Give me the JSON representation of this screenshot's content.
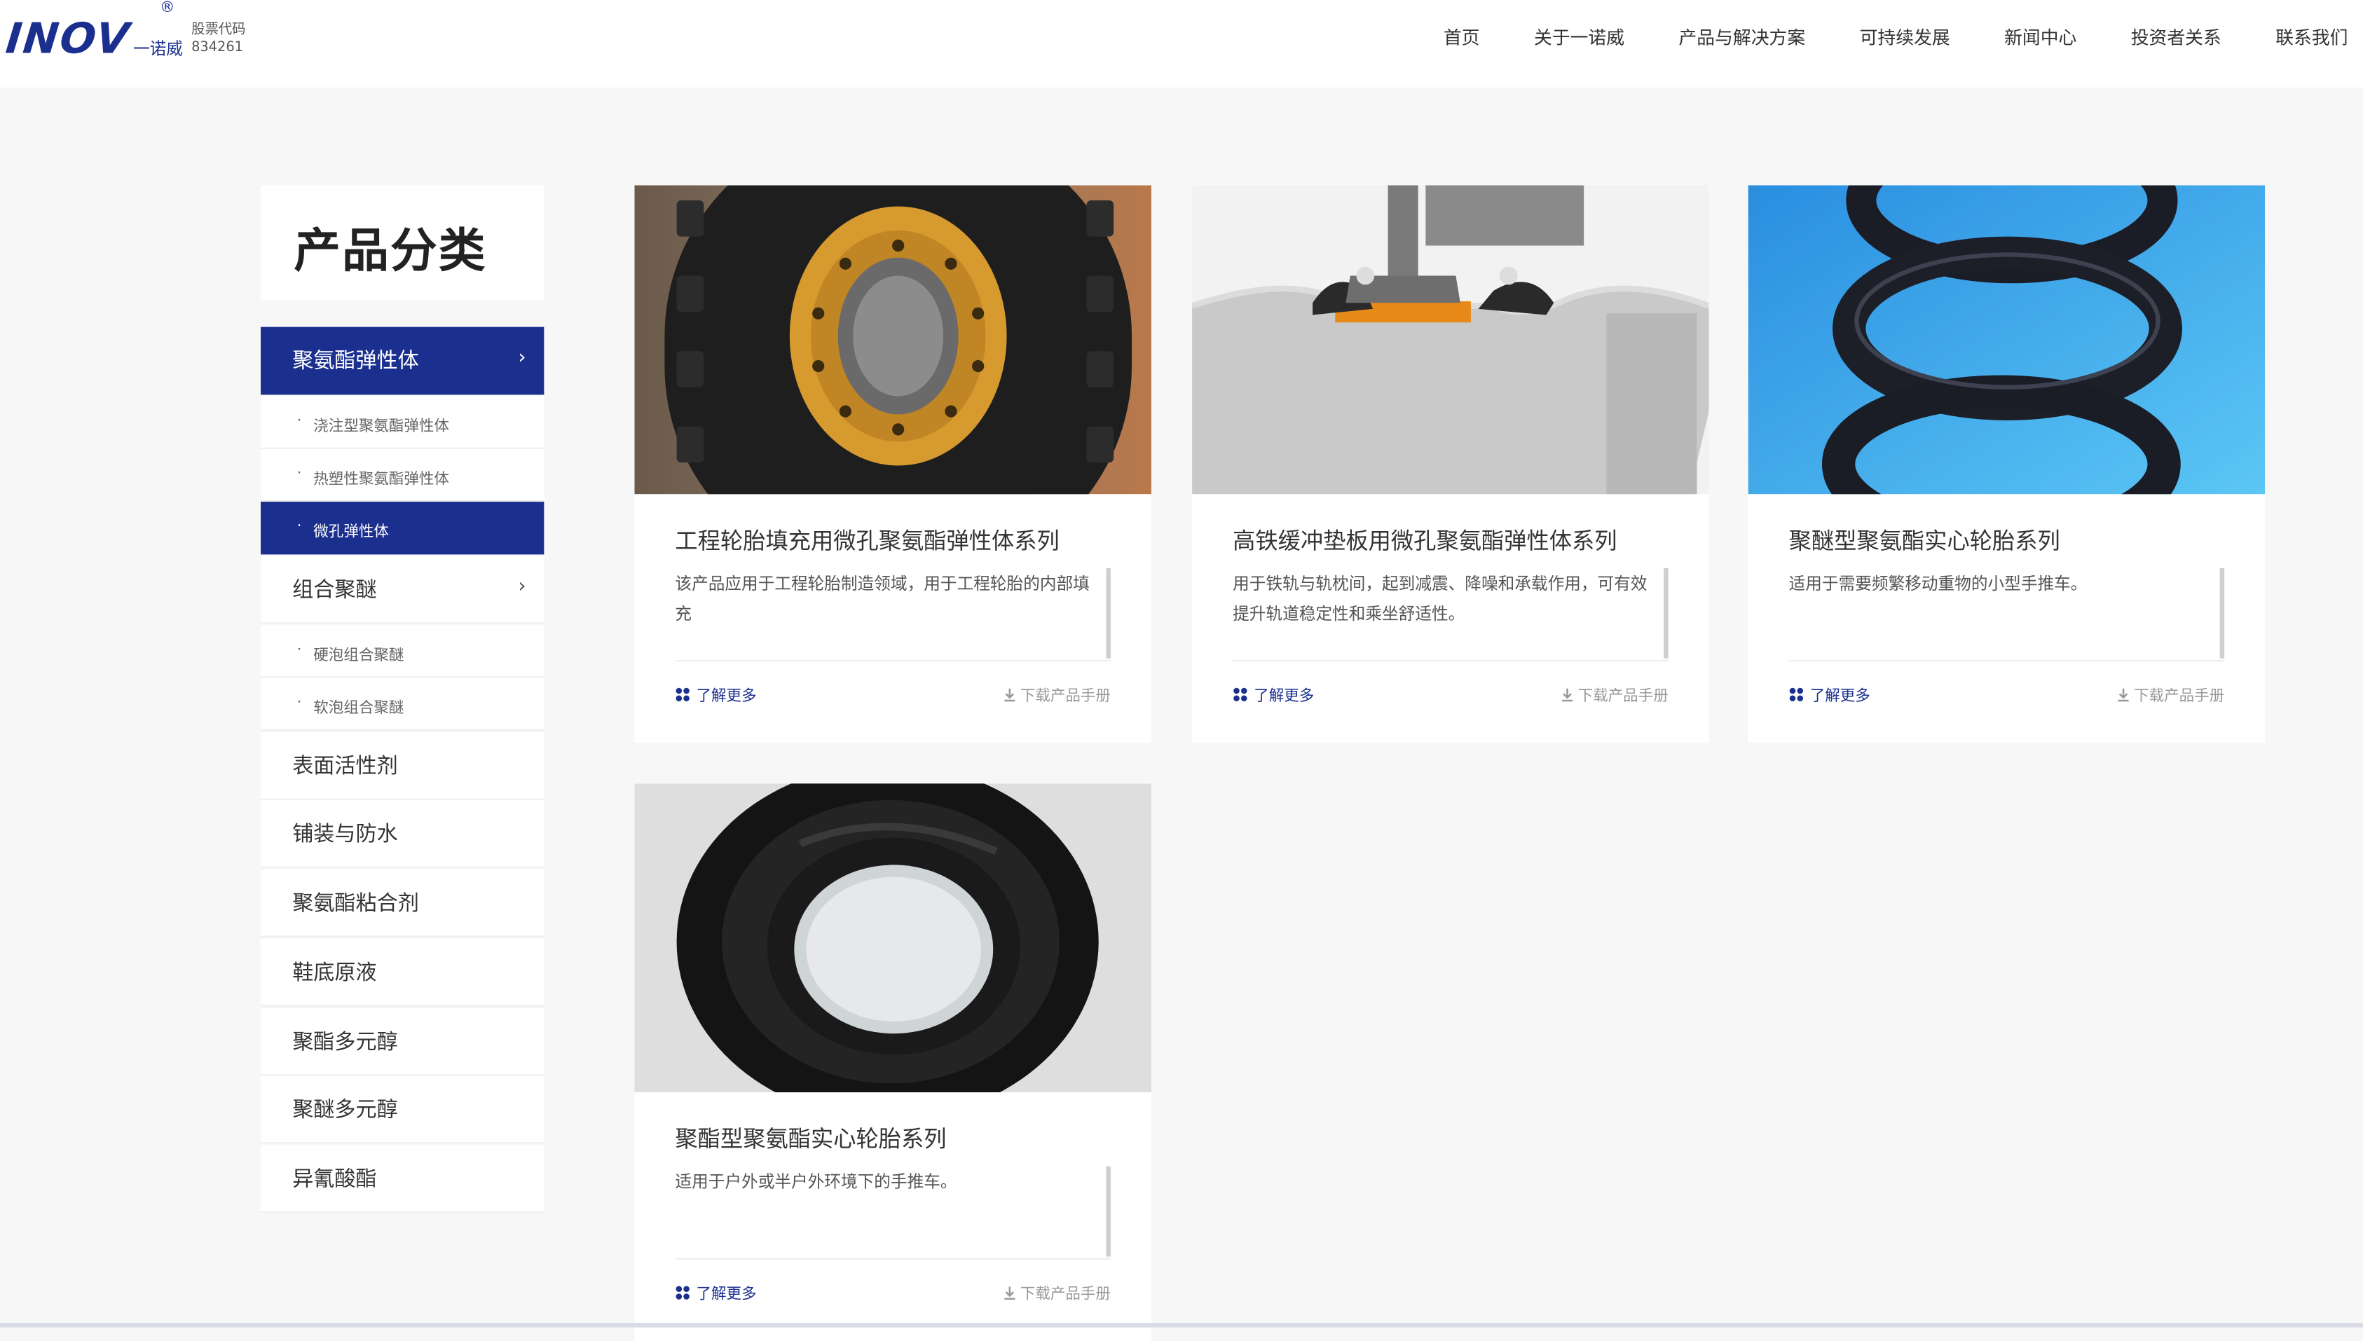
{
  "header": {
    "logo_text": "INOV",
    "logo_cn": "一诺威",
    "logo_reg": "®",
    "stock_label": "股票代码",
    "stock_code": "834261",
    "nav": [
      "首页",
      "关于一诺威",
      "产品与解决方案",
      "可持续发展",
      "新闻中心",
      "投资者关系",
      "联系我们"
    ]
  },
  "sidebar": {
    "title": "产品分类",
    "items": [
      {
        "label": "聚氨酯弹性体",
        "type": "main",
        "active": true,
        "chevron": true
      },
      {
        "label": "浇注型聚氨酯弹性体",
        "type": "sub"
      },
      {
        "label": "热塑性聚氨酯弹性体",
        "type": "sub"
      },
      {
        "label": "微孔弹性体",
        "type": "sub",
        "active": true
      },
      {
        "label": "组合聚醚",
        "type": "main",
        "chevron": true
      },
      {
        "label": "硬泡组合聚醚",
        "type": "sub"
      },
      {
        "label": "软泡组合聚醚",
        "type": "sub"
      },
      {
        "label": "表面活性剂",
        "type": "main"
      },
      {
        "label": "铺装与防水",
        "type": "main"
      },
      {
        "label": "聚氨酯粘合剂",
        "type": "main"
      },
      {
        "label": "鞋底原液",
        "type": "main"
      },
      {
        "label": "聚酯多元醇",
        "type": "main"
      },
      {
        "label": "聚醚多元醇",
        "type": "main"
      },
      {
        "label": "异氰酸酯",
        "type": "main"
      }
    ],
    "bullet": "·",
    "chevron": "›"
  },
  "products": [
    {
      "title": "工程轮胎填充用微孔聚氨酯弹性体系列",
      "desc": "该产品应用于工程轮胎制造领域，用于工程轮胎的内部填充",
      "image": "tire-with-yellow-rim"
    },
    {
      "title": "高铁缓冲垫板用微孔聚氨酯弹性体系列",
      "desc": "用于铁轨与轨枕间，起到减震、降噪和承载作用，可有效提升轨道稳定性和乘坐舒适性。",
      "image": "rail-on-concrete-sleeper"
    },
    {
      "title": "聚醚型聚氨酯实心轮胎系列",
      "desc": "适用于需要频繁移动重物的小型手推车。",
      "image": "stacked-black-rings-blue-bg"
    },
    {
      "title": "聚酯型聚氨酯实心轮胎系列",
      "desc": "适用于户外或半户外环境下的手推车。",
      "image": "black-solid-tire-closeup"
    }
  ],
  "card_actions": {
    "more": "了解更多",
    "download": "下载产品手册"
  },
  "colors": {
    "brand": "#1b2f8f",
    "bg": "#f7f7f7"
  }
}
